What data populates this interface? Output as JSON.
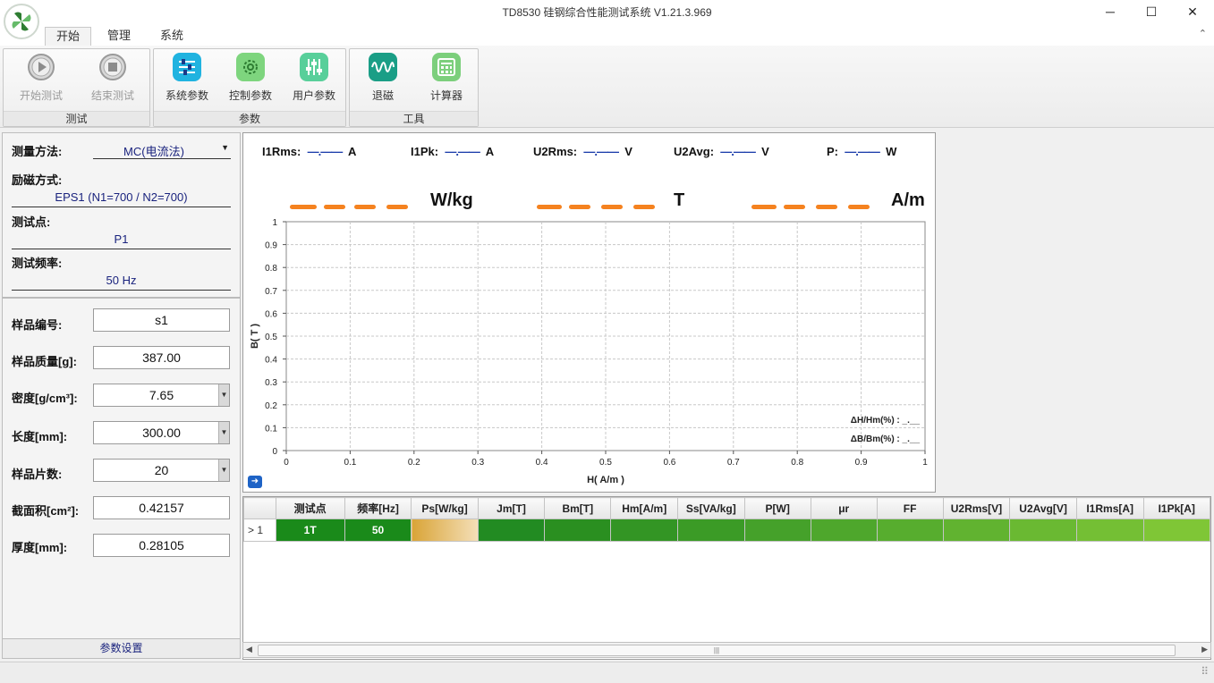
{
  "window": {
    "title": "TD8530 硅钢综合性能测试系统 V1.21.3.969",
    "minimize_glyph": "─",
    "maximize_glyph": "☐",
    "close_glyph": "✕"
  },
  "tabs": [
    {
      "label": "开始",
      "active": true
    },
    {
      "label": "管理",
      "active": false
    },
    {
      "label": "系统",
      "active": false
    }
  ],
  "ribbon": {
    "collapse_glyph": "⌃",
    "groups": [
      {
        "label": "测试",
        "buttons": [
          {
            "label": "开始测试",
            "icon": "play-icon",
            "enabled": false
          },
          {
            "label": "结束测试",
            "icon": "stop-icon",
            "enabled": false
          }
        ]
      },
      {
        "label": "参数",
        "buttons": [
          {
            "label": "系统参数",
            "icon": "sliders-icon",
            "color": "#20b3e0"
          },
          {
            "label": "控制参数",
            "icon": "gear-icon",
            "color": "#58c45a"
          },
          {
            "label": "用户参数",
            "icon": "user-sliders-icon",
            "color": "#46c28c"
          }
        ]
      },
      {
        "label": "工具",
        "buttons": [
          {
            "label": "退磁",
            "icon": "waveform-icon",
            "color": "#1a9e86"
          },
          {
            "label": "计算器",
            "icon": "calculator-icon",
            "color": "#6cc56c"
          }
        ]
      }
    ]
  },
  "settings": {
    "method_label": "测量方法:",
    "method_value": "MC(电流法)",
    "excitation_label": "励磁方式:",
    "excitation_value": "EPS1 (N1=700 / N2=700)",
    "testpoint_label": "测试点:",
    "testpoint_value": "P1",
    "freq_label": "测试频率:",
    "freq_value": "50 Hz",
    "footer": "参数设置"
  },
  "sample": [
    {
      "label": "样品编号:",
      "value": "s1",
      "combo": false
    },
    {
      "label": "样品质量[g]:",
      "value": "387.00",
      "combo": false
    },
    {
      "label": "密度[g/cm³]:",
      "value": "7.65",
      "combo": true
    },
    {
      "label": "长度[mm]:",
      "value": "300.00",
      "combo": true
    },
    {
      "label": "样品片数:",
      "value": "20",
      "combo": true
    },
    {
      "label": "截面积[cm²]:",
      "value": "0.42157",
      "combo": false
    },
    {
      "label": "厚度[mm]:",
      "value": "0.28105",
      "combo": false
    }
  ],
  "readouts": [
    {
      "name": "I1Rms:",
      "value": "—.——",
      "unit": "A"
    },
    {
      "name": "I1Pk:",
      "value": "—.——",
      "unit": "A"
    },
    {
      "name": "U2Rms:",
      "value": "—.——",
      "unit": "V"
    },
    {
      "name": "U2Avg:",
      "value": "—.——",
      "unit": "V"
    },
    {
      "name": "P:",
      "value": "—.——",
      "unit": "W"
    }
  ],
  "big_units": [
    "W/kg",
    "T",
    "A/m"
  ],
  "chart_data": {
    "type": "line",
    "title": "",
    "xlabel": "H( A/m )",
    "ylabel": "B( T )",
    "xlim": [
      0,
      1
    ],
    "ylim": [
      0,
      1
    ],
    "x_ticks": [
      "0",
      "0.1",
      "0.2",
      "0.3",
      "0.4",
      "0.5",
      "0.6",
      "0.7",
      "0.8",
      "0.9",
      "1"
    ],
    "y_ticks": [
      "0",
      "0.1",
      "0.2",
      "0.3",
      "0.4",
      "0.5",
      "0.6",
      "0.7",
      "0.8",
      "0.9",
      "1"
    ],
    "grid": true,
    "series": [],
    "annotations": [
      "ΔH/Hm(%) : _.__",
      "ΔB/Bm(%) : _.__"
    ]
  },
  "table": {
    "columns": [
      "测试点",
      "频率[Hz]",
      "Ps[W/kg]",
      "Jm[T]",
      "Bm[T]",
      "Hm[A/m]",
      "Ss[VA/kg]",
      "P[W]",
      "μr",
      "FF",
      "U2Rms[V]",
      "U2Avg[V]",
      "I1Rms[A]",
      "I1Pk[A]"
    ],
    "rows": [
      {
        "indicator": "> 1",
        "cells": [
          "1T",
          "50",
          "",
          "",
          "",
          "",
          "",
          "",
          "",
          "",
          "",
          "",
          "",
          ""
        ]
      }
    ],
    "cell_colors": [
      "#1a8a1a",
      "#1a8a1a",
      "#e8c27a",
      "#228b22",
      "#2a8f20",
      "#339524",
      "#3b9b26",
      "#45a12a",
      "#4ea72c",
      "#57ad2e",
      "#61b330",
      "#6ab932",
      "#74bf34",
      "#7fc636"
    ]
  },
  "scroll_grip": "|||",
  "scroll_left": "◀",
  "scroll_right": "▶",
  "status_grip": "⠿"
}
